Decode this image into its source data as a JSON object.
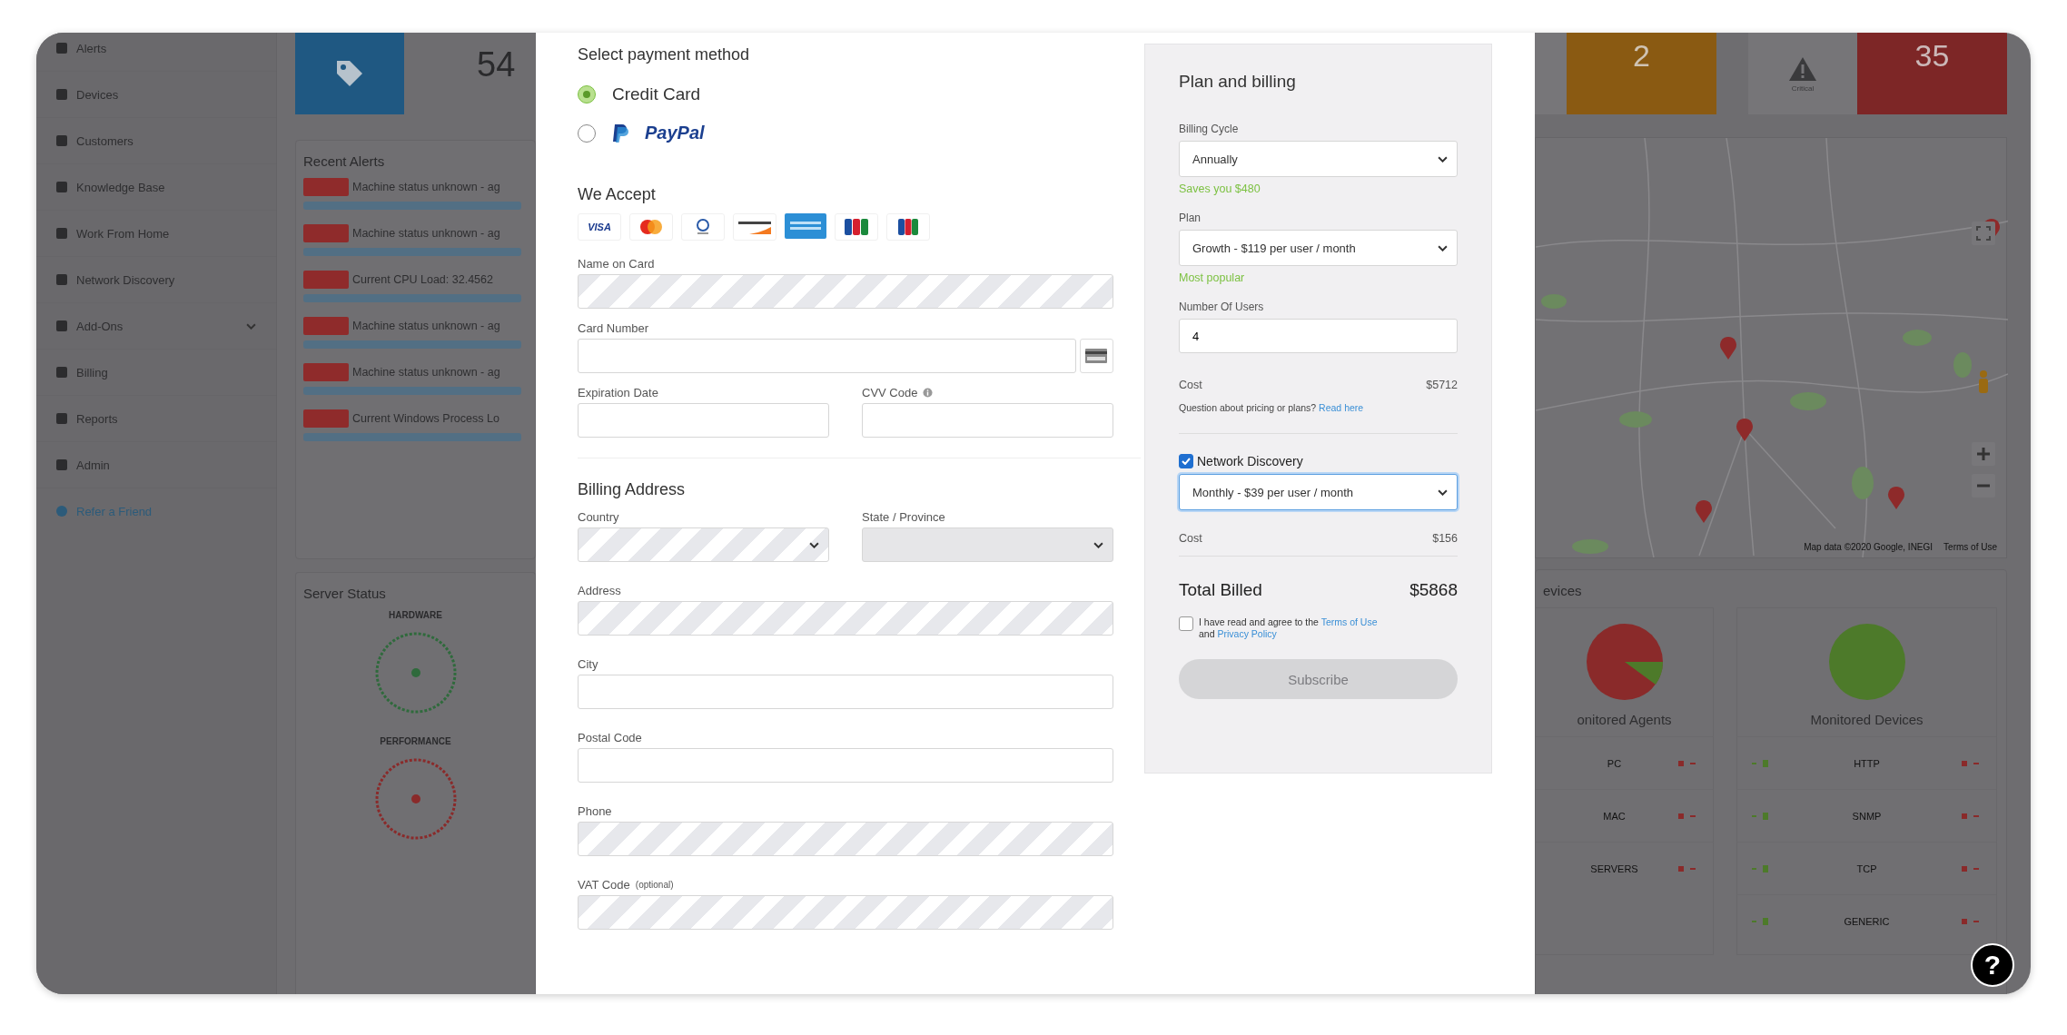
{
  "sidebar": {
    "items": [
      {
        "label": "Alerts",
        "kind": "item"
      },
      {
        "label": "Devices",
        "kind": "item"
      },
      {
        "label": "Customers",
        "kind": "item"
      },
      {
        "label": "Knowledge Base",
        "kind": "item"
      },
      {
        "label": "Work From Home",
        "kind": "item"
      },
      {
        "label": "Network Discovery",
        "kind": "item"
      },
      {
        "label": "Add-Ons",
        "kind": "group"
      },
      {
        "label": "Billing",
        "kind": "item"
      },
      {
        "label": "Reports",
        "kind": "item"
      },
      {
        "label": "Admin",
        "kind": "item"
      },
      {
        "label": "Refer a Friend",
        "kind": "link"
      }
    ]
  },
  "summary_tiles_left": [
    {
      "kind": "tag-tile"
    },
    {
      "kind": "count",
      "text": "54"
    }
  ],
  "recent_alerts": {
    "title": "Recent Alerts",
    "rows": [
      {
        "text": "Machine status unknown - ag"
      },
      {
        "text": "Machine status unknown - ag"
      },
      {
        "text": "Current CPU Load: 32.4562"
      },
      {
        "text": "Machine status unknown - ag"
      },
      {
        "text": "Machine status unknown - ag"
      },
      {
        "text": "Current Windows Process Lo"
      }
    ]
  },
  "server_status": {
    "title": "Server Status",
    "gauges": [
      {
        "label": "HARDWARE",
        "kind": "ok"
      },
      {
        "label": "PERFORMANCE",
        "kind": "critical"
      }
    ]
  },
  "summary_tiles_right": [
    {
      "kind": "edge"
    },
    {
      "kind": "warning",
      "text": "2"
    },
    {
      "kind": "icon-label",
      "text": "Critical"
    },
    {
      "kind": "critical",
      "text": "35"
    }
  ],
  "map": {
    "attribution": "Map data ©2020 Google, INEGI",
    "terms": "Terms of Use"
  },
  "devices": {
    "title": "evices",
    "groups": [
      {
        "title": "onitored Agents",
        "kind": "mixed",
        "rows": [
          "PC",
          "MAC",
          "SERVERS"
        ]
      },
      {
        "title": "Monitored Devices",
        "kind": "ok",
        "rows": [
          "HTTP",
          "SNMP",
          "TCP",
          "GENERIC"
        ]
      }
    ]
  },
  "help_button": {
    "text": "?"
  },
  "payment": {
    "title": "Select payment method",
    "methods": [
      {
        "kind": "card",
        "label": "Credit Card",
        "selected": true
      },
      {
        "kind": "paypal",
        "label": "PayPal",
        "selected": false
      }
    ],
    "accept_title": "We Accept",
    "card_brands": [
      {
        "kind": "visa",
        "text": "VISA"
      },
      {
        "kind": "mastercard"
      },
      {
        "kind": "diners"
      },
      {
        "kind": "discover"
      },
      {
        "kind": "amex"
      },
      {
        "kind": "jcb-alt"
      },
      {
        "kind": "jcb"
      }
    ],
    "rows": [
      [
        {
          "label": "Name on Card",
          "kind": "input",
          "loading": true
        }
      ],
      [
        {
          "label": "Card Number",
          "kind": "card-number",
          "loading": false
        }
      ],
      [
        {
          "label": "Expiration Date",
          "kind": "input",
          "loading": false
        },
        {
          "label": "CVV Code",
          "kind": "input",
          "loading": false,
          "info": true
        }
      ]
    ]
  },
  "billing_address": {
    "title": "Billing Address",
    "rows": [
      [
        {
          "label": "Country",
          "kind": "select",
          "loading": true,
          "disabled": false
        },
        {
          "label": "State / Province",
          "kind": "select",
          "loading": false,
          "disabled": true
        }
      ],
      [
        {
          "label": "Address",
          "kind": "input",
          "loading": true
        }
      ],
      [
        {
          "label": "City",
          "kind": "input",
          "loading": false
        }
      ],
      [
        {
          "label": "Postal Code",
          "kind": "input",
          "loading": false
        }
      ],
      [
        {
          "label": "Phone",
          "kind": "input",
          "loading": true
        }
      ],
      [
        {
          "label": "VAT Code",
          "hint": "(optional)",
          "kind": "input",
          "loading": true
        }
      ]
    ]
  },
  "plan": {
    "title": "Plan and billing",
    "fields": [
      {
        "label": "Billing Cycle",
        "kind": "select",
        "value": "Annually",
        "note": "Saves you $480"
      },
      {
        "label": "Plan",
        "kind": "select",
        "value": "Growth - $119 per user / month",
        "note": "Most popular"
      },
      {
        "label": "Number Of Users",
        "kind": "input",
        "value": "4"
      }
    ],
    "cost": {
      "label": "Cost",
      "value": "$5712"
    },
    "question": {
      "text": "Question about pricing or plans?",
      "link": "Read here"
    },
    "addon": {
      "label": "Network Discovery",
      "checked": true,
      "select": "Monthly - $39 per user / month",
      "focused": true
    },
    "addon_cost": {
      "label": "Cost",
      "value": "$156"
    },
    "total": {
      "label": "Total Billed",
      "value": "$5868"
    },
    "agree": {
      "checked": false,
      "text": "I have read and agree to the",
      "terms": "Terms of Use",
      "and": "and",
      "privacy": "Privacy Policy"
    },
    "subscribe": {
      "label": "Subscribe",
      "disabled": true
    }
  }
}
